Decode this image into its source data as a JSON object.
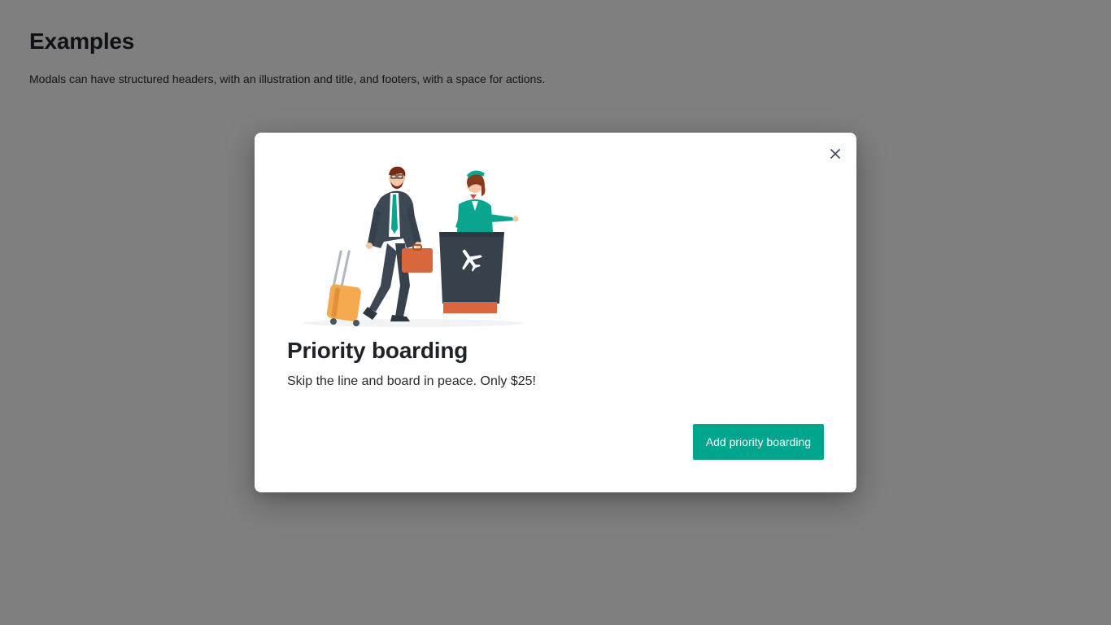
{
  "page": {
    "title": "Examples",
    "description": "Modals can have structured headers, with an illustration and title, and footers, with a space for actions."
  },
  "modal": {
    "title": "Priority boarding",
    "subtitle": "Skip the line and board in peace. Only $25!",
    "primary_action_label": "Add priority boarding",
    "close_icon": "close-icon",
    "illustration": "priority-boarding-illustration"
  },
  "colors": {
    "primary": "#00a58e",
    "overlay": "rgba(0,0,0,0.5)",
    "text": "#1f2328"
  }
}
